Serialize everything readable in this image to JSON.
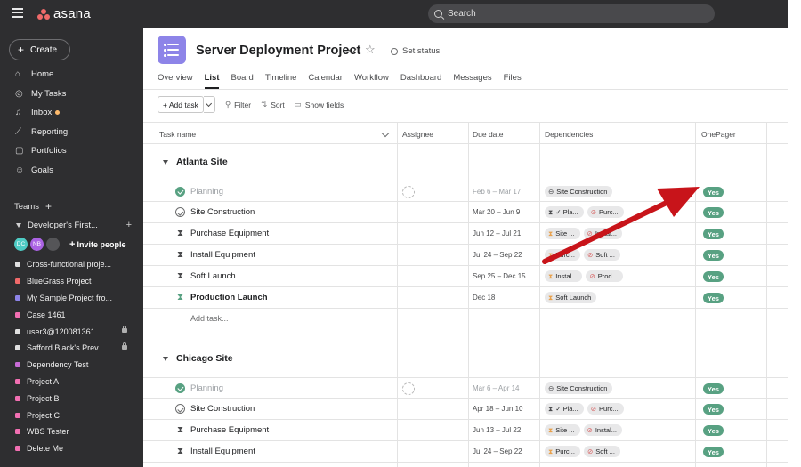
{
  "app": {
    "name": "asana"
  },
  "search": {
    "placeholder": "Search"
  },
  "sidebar": {
    "create_label": "Create",
    "nav": [
      {
        "label": "Home",
        "icon": "home-icon"
      },
      {
        "label": "My Tasks",
        "icon": "check-circle-icon"
      },
      {
        "label": "Inbox",
        "icon": "bell-icon"
      },
      {
        "label": "Reporting",
        "icon": "trend-line-icon"
      },
      {
        "label": "Portfolios",
        "icon": "folder-icon"
      },
      {
        "label": "Goals",
        "icon": "person-icon"
      }
    ],
    "teams_label": "Teams",
    "team_name": "Developer's First...",
    "avatars": [
      {
        "initials": "DC",
        "color": "#4ecbc4"
      },
      {
        "initials": "NB",
        "color": "#aa62e3"
      },
      {
        "initials": "",
        "color": "#555558"
      }
    ],
    "invite_label": "Invite people",
    "projects": [
      {
        "label": "Cross-functional proje...",
        "color": "#e0e0e0",
        "locked": false
      },
      {
        "label": "BlueGrass Project",
        "color": "#f06a6a",
        "locked": false
      },
      {
        "label": "My Sample Project fro...",
        "color": "#8d84e8",
        "locked": false
      },
      {
        "label": "Case 1461",
        "color": "#f26fb2",
        "locked": false
      },
      {
        "label": "user3@120081361...",
        "color": "#e0e0e0",
        "locked": true
      },
      {
        "label": "Safford Black's Prev...",
        "color": "#e0e0e0",
        "locked": true
      },
      {
        "label": "Dependency Test",
        "color": "#c86bd6",
        "locked": false
      },
      {
        "label": "Project A",
        "color": "#f26fb2",
        "locked": false
      },
      {
        "label": "Project B",
        "color": "#f26fb2",
        "locked": false
      },
      {
        "label": "Project C",
        "color": "#f26fb2",
        "locked": false
      },
      {
        "label": "WBS Tester",
        "color": "#f26fb2",
        "locked": false
      },
      {
        "label": "Delete Me",
        "color": "#f26fb2",
        "locked": false
      }
    ]
  },
  "header": {
    "title": "Server Deployment Project",
    "set_status": "Set status",
    "tabs": [
      "Overview",
      "List",
      "Board",
      "Timeline",
      "Calendar",
      "Workflow",
      "Dashboard",
      "Messages",
      "Files"
    ]
  },
  "toolbar": {
    "add_task": "+ Add task",
    "filter": "Filter",
    "sort": "Sort",
    "show_fields": "Show fields"
  },
  "columns": {
    "task_name": "Task name",
    "assignee": "Assignee",
    "due_date": "Due date",
    "dependencies": "Dependencies",
    "onepager": "OnePager"
  },
  "add_task_inline": "Add task...",
  "sections": [
    {
      "title": "Atlanta Site",
      "rows": [
        {
          "name": "Planning",
          "status": "done",
          "assignee": true,
          "due": "Feb 6 – Mar 17",
          "deps": [
            {
              "icon": "circle-minus",
              "label": "Site Construction"
            }
          ],
          "onepager": "Yes"
        },
        {
          "name": "Site Construction",
          "status": "check",
          "assignee": false,
          "due": "Mar 20 – Jun 9",
          "deps": [
            {
              "icon": "hourglass",
              "label": "✓ Pla..."
            },
            {
              "icon": "block",
              "label": "Purc..."
            }
          ],
          "onepager": "Yes"
        },
        {
          "name": "Purchase Equipment",
          "status": "hourglass",
          "assignee": false,
          "due": "Jun 12 – Jul 21",
          "deps": [
            {
              "icon": "hourglass-orange",
              "label": "Site ..."
            },
            {
              "icon": "block",
              "label": "Instal..."
            }
          ],
          "onepager": "Yes"
        },
        {
          "name": "Install Equipment",
          "status": "hourglass",
          "assignee": false,
          "due": "Jul 24 – Sep 22",
          "deps": [
            {
              "icon": "hourglass-orange",
              "label": "Purc..."
            },
            {
              "icon": "block",
              "label": "Soft ..."
            }
          ],
          "onepager": "Yes"
        },
        {
          "name": "Soft Launch",
          "status": "hourglass",
          "assignee": false,
          "due": "Sep 25 – Dec 15",
          "deps": [
            {
              "icon": "hourglass-orange",
              "label": "Instal..."
            },
            {
              "icon": "block",
              "label": "Prod..."
            }
          ],
          "onepager": "Yes"
        },
        {
          "name": "Production Launch",
          "status": "hourglass-green",
          "bold": true,
          "assignee": false,
          "due": "Dec 18",
          "deps": [
            {
              "icon": "hourglass-orange",
              "label": "Soft Launch"
            }
          ],
          "onepager": "Yes"
        }
      ]
    },
    {
      "title": "Chicago Site",
      "rows": [
        {
          "name": "Planning",
          "status": "done",
          "assignee": true,
          "due": "Mar 6 – Apr 14",
          "deps": [
            {
              "icon": "circle-minus",
              "label": "Site Construction"
            }
          ],
          "onepager": "Yes"
        },
        {
          "name": "Site Construction",
          "status": "check",
          "assignee": false,
          "due": "Apr 18 – Jun 10",
          "deps": [
            {
              "icon": "hourglass",
              "label": "✓ Pla..."
            },
            {
              "icon": "block",
              "label": "Purc..."
            }
          ],
          "onepager": "Yes"
        },
        {
          "name": "Purchase Equipment",
          "status": "hourglass",
          "assignee": false,
          "due": "Jun 13 – Jul 22",
          "deps": [
            {
              "icon": "hourglass-orange",
              "label": "Site ..."
            },
            {
              "icon": "block",
              "label": "Instal..."
            }
          ],
          "onepager": "Yes"
        },
        {
          "name": "Install Equipment",
          "status": "hourglass",
          "assignee": false,
          "due": "Jul 24 – Sep 22",
          "deps": [
            {
              "icon": "hourglass-orange",
              "label": "Purc..."
            },
            {
              "icon": "block",
              "label": "Soft ..."
            }
          ],
          "onepager": "Yes"
        }
      ]
    }
  ],
  "colors": {
    "topbar": "#2e2e30",
    "accent_green": "#58a182",
    "annotation_arrow": "#c8141a"
  }
}
